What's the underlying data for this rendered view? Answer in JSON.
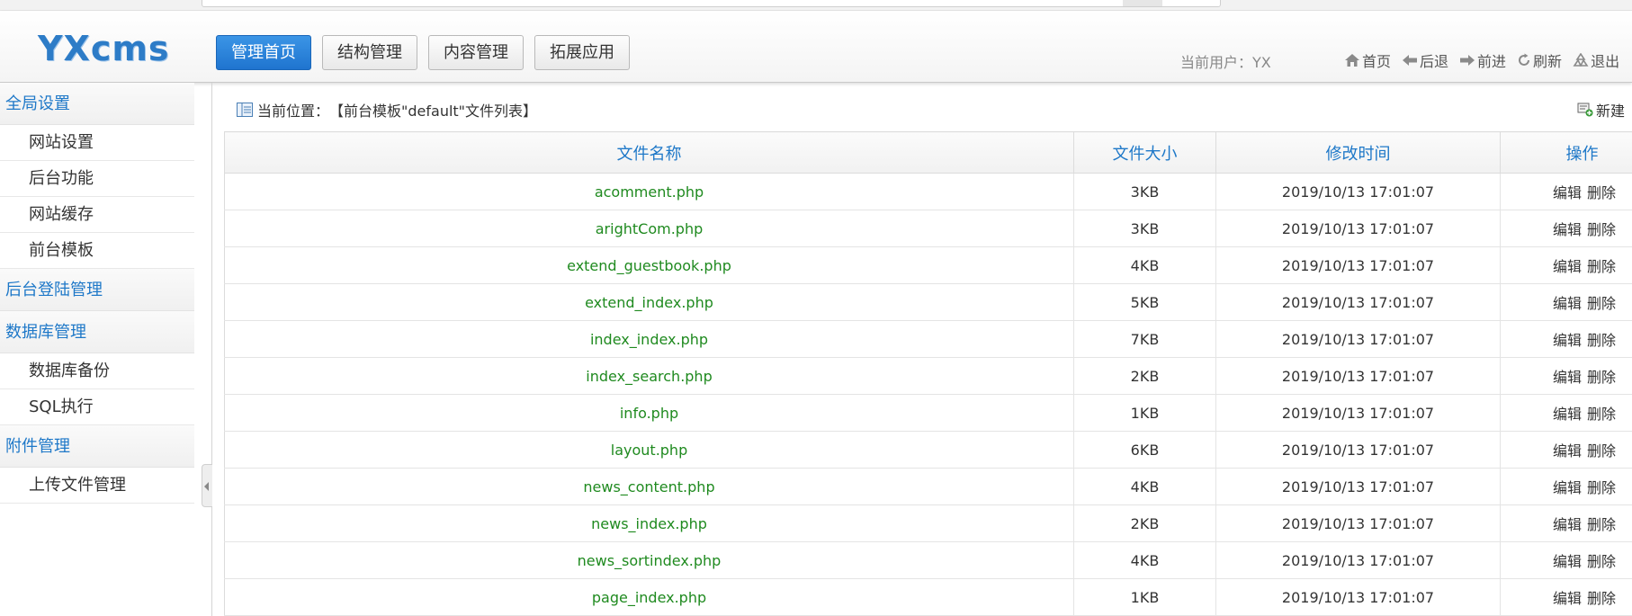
{
  "header": {
    "logo": "YXcms",
    "nav": [
      {
        "label": "管理首页",
        "active": true
      },
      {
        "label": "结构管理",
        "active": false
      },
      {
        "label": "内容管理",
        "active": false
      },
      {
        "label": "拓展应用",
        "active": false
      }
    ],
    "current_user": "当前用户：YX",
    "quick": [
      {
        "label": "首页",
        "icon": "home-icon"
      },
      {
        "label": "后退",
        "icon": "back-arrow-icon"
      },
      {
        "label": "前进",
        "icon": "forward-arrow-icon"
      },
      {
        "label": "刷新",
        "icon": "refresh-icon"
      },
      {
        "label": "退出",
        "icon": "recycle-icon"
      }
    ]
  },
  "sidebar": {
    "groups": [
      {
        "title": "全局设置",
        "items": [
          "网站设置",
          "后台功能",
          "网站缓存",
          "前台模板"
        ]
      },
      {
        "title": "后台登陆管理",
        "items": []
      },
      {
        "title": "数据库管理",
        "items": [
          "数据库备份",
          "SQL执行"
        ]
      },
      {
        "title": "附件管理",
        "items": [
          "上传文件管理"
        ]
      }
    ]
  },
  "main": {
    "breadcrumb_label": "当前位置：",
    "breadcrumb_value": "【前台模板\"default\"文件列表】",
    "new_label": "新建",
    "columns": [
      "文件名称",
      "文件大小",
      "修改时间",
      "操作"
    ],
    "edit_label": "编辑",
    "delete_label": "删除",
    "rows": [
      {
        "name": "acomment.php",
        "size": "3KB",
        "time": "2019/10/13 17:01:07"
      },
      {
        "name": "arightCom.php",
        "size": "3KB",
        "time": "2019/10/13 17:01:07"
      },
      {
        "name": "extend_guestbook.php",
        "size": "4KB",
        "time": "2019/10/13 17:01:07"
      },
      {
        "name": "extend_index.php",
        "size": "5KB",
        "time": "2019/10/13 17:01:07"
      },
      {
        "name": "index_index.php",
        "size": "7KB",
        "time": "2019/10/13 17:01:07"
      },
      {
        "name": "index_search.php",
        "size": "2KB",
        "time": "2019/10/13 17:01:07"
      },
      {
        "name": "info.php",
        "size": "1KB",
        "time": "2019/10/13 17:01:07"
      },
      {
        "name": "layout.php",
        "size": "6KB",
        "time": "2019/10/13 17:01:07"
      },
      {
        "name": "news_content.php",
        "size": "4KB",
        "time": "2019/10/13 17:01:07"
      },
      {
        "name": "news_index.php",
        "size": "2KB",
        "time": "2019/10/13 17:01:07"
      },
      {
        "name": "news_sortindex.php",
        "size": "4KB",
        "time": "2019/10/13 17:01:07"
      },
      {
        "name": "page_index.php",
        "size": "1KB",
        "time": "2019/10/13 17:01:07"
      }
    ]
  },
  "colors": {
    "accent": "#1e78c8",
    "active_button": "#2b84dc",
    "file_name": "#1f8a1f"
  }
}
